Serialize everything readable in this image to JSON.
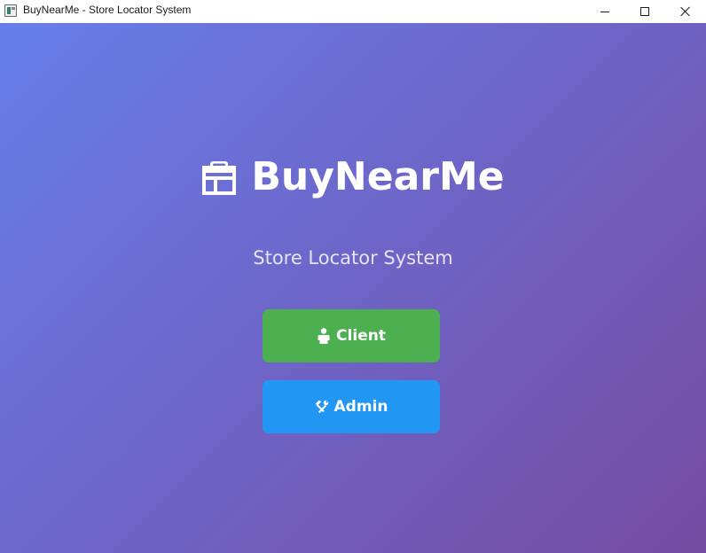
{
  "window": {
    "title": "BuyNearMe - Store Locator System"
  },
  "header": {
    "app_name": "BuyNearMe",
    "icon": "store-icon"
  },
  "subtitle": "Store Locator System",
  "buttons": {
    "client": {
      "label": "Client",
      "icon": "person-icon",
      "color": "#4caf50"
    },
    "admin": {
      "label": "Admin",
      "icon": "tools-icon",
      "color": "#2196f3"
    }
  },
  "theme": {
    "gradient_start": "#667eea",
    "gradient_end": "#764ba2",
    "text": "#ffffff"
  }
}
